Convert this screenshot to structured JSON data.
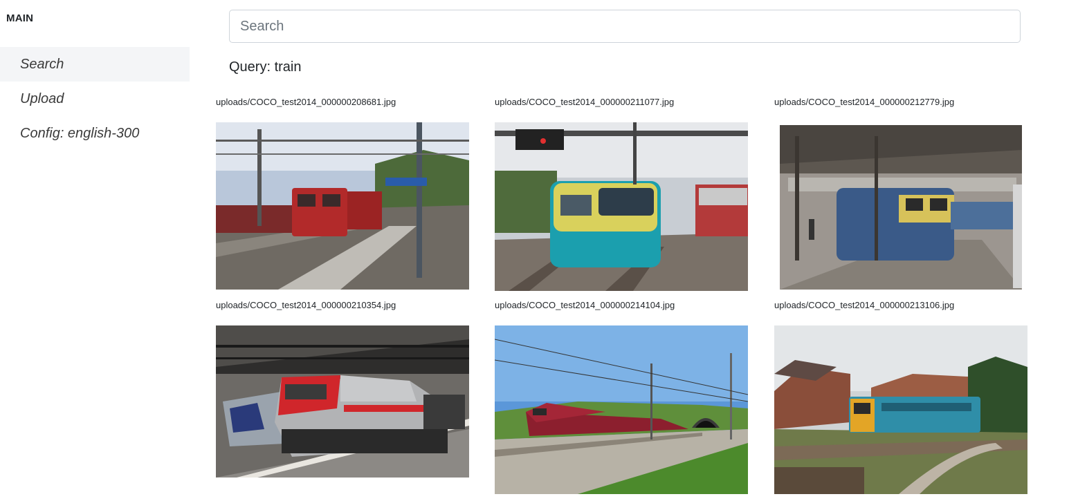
{
  "sidebar": {
    "heading": "MAIN",
    "items": [
      {
        "label": "Search",
        "active": true
      },
      {
        "label": "Upload",
        "active": false
      },
      {
        "label": "Config: english-300",
        "active": false
      }
    ]
  },
  "search": {
    "placeholder": "Search",
    "value": ""
  },
  "query_text": "Query: train",
  "results": [
    {
      "filename": "uploads/COCO_test2014_000000208681.jpg",
      "image": "red-locomotive-station-photo"
    },
    {
      "filename": "uploads/COCO_test2014_000000211077.jpg",
      "image": "yellow-teal-train-photo"
    },
    {
      "filename": "uploads/COCO_test2014_000000212779.jpg",
      "image": "blue-yellow-diesel-station-photo"
    },
    {
      "filename": "uploads/COCO_test2014_000000210354.jpg",
      "image": "thello-locomotive-station-photo"
    },
    {
      "filename": "uploads/COCO_test2014_000000214104.jpg",
      "image": "red-train-tunnel-photo"
    },
    {
      "filename": "uploads/COCO_test2014_000000213106.jpg",
      "image": "blue-railcar-village-photo"
    }
  ]
}
